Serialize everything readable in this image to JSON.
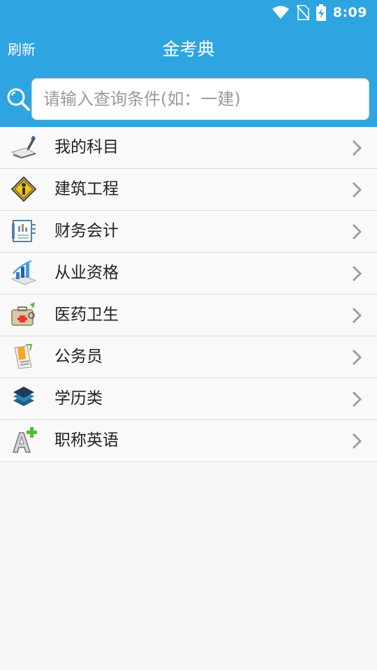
{
  "status_bar": {
    "time": "8:09",
    "icons": [
      "wifi-icon",
      "no-sim-icon",
      "battery-charging-icon"
    ]
  },
  "header": {
    "refresh_label": "刷新",
    "title": "金考典"
  },
  "search": {
    "placeholder": "请输入查询条件(如：一建)",
    "value": ""
  },
  "colors": {
    "primary": "#2ea4e0",
    "background": "#f7f7f7",
    "divider": "#dcdcdc",
    "chevron": "#a0a0a0"
  },
  "categories": [
    {
      "label": "我的科目",
      "icon": "pencil-paper-icon"
    },
    {
      "label": "建筑工程",
      "icon": "construction-sign-icon"
    },
    {
      "label": "财务会计",
      "icon": "ledger-icon"
    },
    {
      "label": "从业资格",
      "icon": "bar-chart-icon"
    },
    {
      "label": "医药卫生",
      "icon": "medical-kit-icon"
    },
    {
      "label": "公务员",
      "icon": "document-icon"
    },
    {
      "label": "学历类",
      "icon": "layers-icon"
    },
    {
      "label": "职称英语",
      "icon": "letter-a-plus-icon"
    }
  ]
}
